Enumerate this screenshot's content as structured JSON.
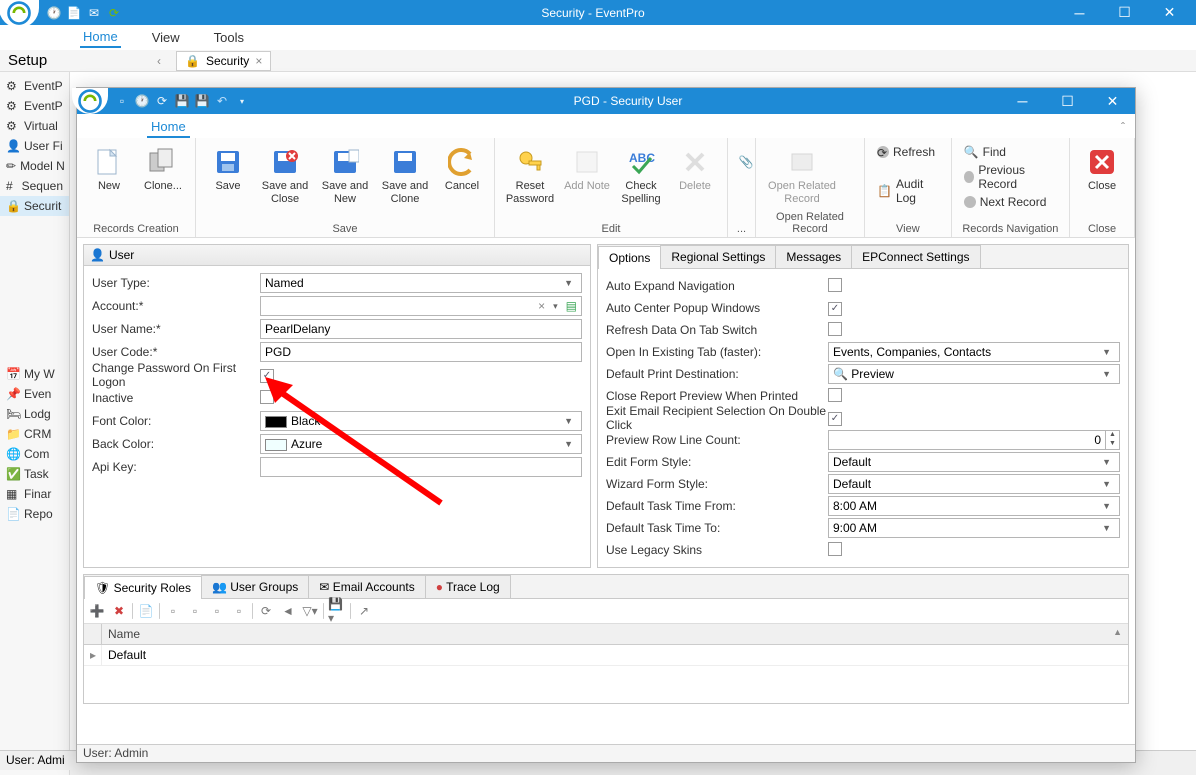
{
  "outer": {
    "title": "Security - EventPro",
    "ribbon_tabs": [
      "Home",
      "View",
      "Tools"
    ],
    "setup_title": "Setup",
    "sidebar": [
      {
        "label": "EventP",
        "icon": "gear"
      },
      {
        "label": "EventP",
        "icon": "gear"
      },
      {
        "label": "Virtual",
        "icon": "gear"
      },
      {
        "label": "User Fi",
        "icon": "user"
      },
      {
        "label": "Model N",
        "icon": "pencil"
      },
      {
        "label": "Sequen",
        "icon": "hash"
      },
      {
        "label": "Securit",
        "icon": "lock",
        "selected": true
      }
    ],
    "sidebar_lower": [
      {
        "label": "My W",
        "icon": "calendar"
      },
      {
        "label": "Even",
        "icon": "pin"
      },
      {
        "label": "Lodg",
        "icon": "bed"
      },
      {
        "label": "CRM",
        "icon": "folder"
      },
      {
        "label": "Com",
        "icon": "globe"
      },
      {
        "label": "Task",
        "icon": "check"
      },
      {
        "label": "Finar",
        "icon": "table"
      },
      {
        "label": "Repo",
        "icon": "report"
      }
    ],
    "dock_tab": "Security",
    "status": "User: Admi"
  },
  "inner": {
    "title": "PGD - Security User",
    "ribbon_tab": "Home",
    "groups": {
      "records_creation": {
        "label": "Records Creation",
        "buttons": [
          {
            "name": "new",
            "label": "New"
          },
          {
            "name": "clone",
            "label": "Clone..."
          }
        ]
      },
      "save": {
        "label": "Save",
        "buttons": [
          {
            "name": "save",
            "label": "Save"
          },
          {
            "name": "save-close",
            "label": "Save and Close"
          },
          {
            "name": "save-new",
            "label": "Save and New"
          },
          {
            "name": "save-clone",
            "label": "Save and Clone"
          },
          {
            "name": "cancel",
            "label": "Cancel"
          }
        ]
      },
      "edit": {
        "label": "Edit",
        "buttons": [
          {
            "name": "reset-password",
            "label": "Reset Password"
          },
          {
            "name": "add-note",
            "label": "Add Note",
            "disabled": true
          },
          {
            "name": "check-spelling",
            "label": "Check Spelling"
          },
          {
            "name": "delete",
            "label": "Delete",
            "disabled": true
          }
        ]
      },
      "open_related": {
        "label": "Open Related Record",
        "buttons": [
          {
            "name": "open-related",
            "label": "Open Related Record",
            "disabled": true
          }
        ]
      },
      "view": {
        "label": "View",
        "items": [
          {
            "name": "refresh",
            "label": "Refresh"
          },
          {
            "name": "audit-log",
            "label": "Audit Log"
          }
        ]
      },
      "records_nav": {
        "label": "Records Navigation",
        "items": [
          {
            "name": "find",
            "label": "Find"
          },
          {
            "name": "prev-record",
            "label": "Previous Record"
          },
          {
            "name": "next-record",
            "label": "Next Record"
          }
        ]
      },
      "close": {
        "label": "Close",
        "buttons": [
          {
            "name": "close",
            "label": "Close"
          }
        ]
      }
    },
    "user_panel": {
      "title": "User",
      "fields": {
        "user_type": {
          "label": "User Type:",
          "value": "Named"
        },
        "account": {
          "label": "Account:*",
          "value": ""
        },
        "user_name": {
          "label": "User Name:*",
          "value": "PearlDelany"
        },
        "user_code": {
          "label": "User Code:*",
          "value": "PGD"
        },
        "change_pw": {
          "label": "Change Password On First Logon",
          "checked": true
        },
        "inactive": {
          "label": "Inactive",
          "checked": false
        },
        "font_color": {
          "label": "Font Color:",
          "value": "Black",
          "swatch": "#000000"
        },
        "back_color": {
          "label": "Back Color:",
          "value": "Azure",
          "swatch": "#f0ffff"
        },
        "api_key": {
          "label": "Api Key:",
          "value": ""
        }
      }
    },
    "options_panel": {
      "tabs": [
        "Options",
        "Regional Settings",
        "Messages",
        "EPConnect Settings"
      ],
      "rows": {
        "auto_expand": {
          "label": "Auto Expand Navigation",
          "type": "check",
          "checked": false
        },
        "auto_center": {
          "label": "Auto Center Popup Windows",
          "type": "check",
          "checked": true
        },
        "refresh_tab": {
          "label": "Refresh Data On Tab Switch",
          "type": "check",
          "checked": false
        },
        "open_existing": {
          "label": "Open In Existing Tab (faster):",
          "type": "combo",
          "value": "Events, Companies, Contacts"
        },
        "print_dest": {
          "label": "Default Print Destination:",
          "type": "combo",
          "value": "Preview",
          "icon": "search"
        },
        "close_report": {
          "label": "Close Report Preview When Printed",
          "type": "check",
          "checked": false
        },
        "exit_email": {
          "label": "Exit Email Recipient Selection On Double Click",
          "type": "check",
          "checked": true
        },
        "row_count": {
          "label": "Preview Row Line Count:",
          "type": "spin",
          "value": "0"
        },
        "edit_form": {
          "label": "Edit Form Style:",
          "type": "combo",
          "value": "Default"
        },
        "wizard_form": {
          "label": "Wizard Form Style:",
          "type": "combo",
          "value": "Default"
        },
        "task_from": {
          "label": "Default Task Time From:",
          "type": "combo",
          "value": "8:00 AM"
        },
        "task_to": {
          "label": "Default Task Time To:",
          "type": "combo",
          "value": "9:00 AM"
        },
        "legacy": {
          "label": "Use Legacy Skins",
          "type": "check",
          "checked": false
        }
      }
    },
    "sub_tabs": {
      "tabs": [
        "Security Roles",
        "User Groups",
        "Email Accounts",
        "Trace Log"
      ],
      "grid": {
        "col": "Name",
        "rows": [
          {
            "name": "Default"
          }
        ]
      }
    },
    "status": "User: Admin"
  }
}
